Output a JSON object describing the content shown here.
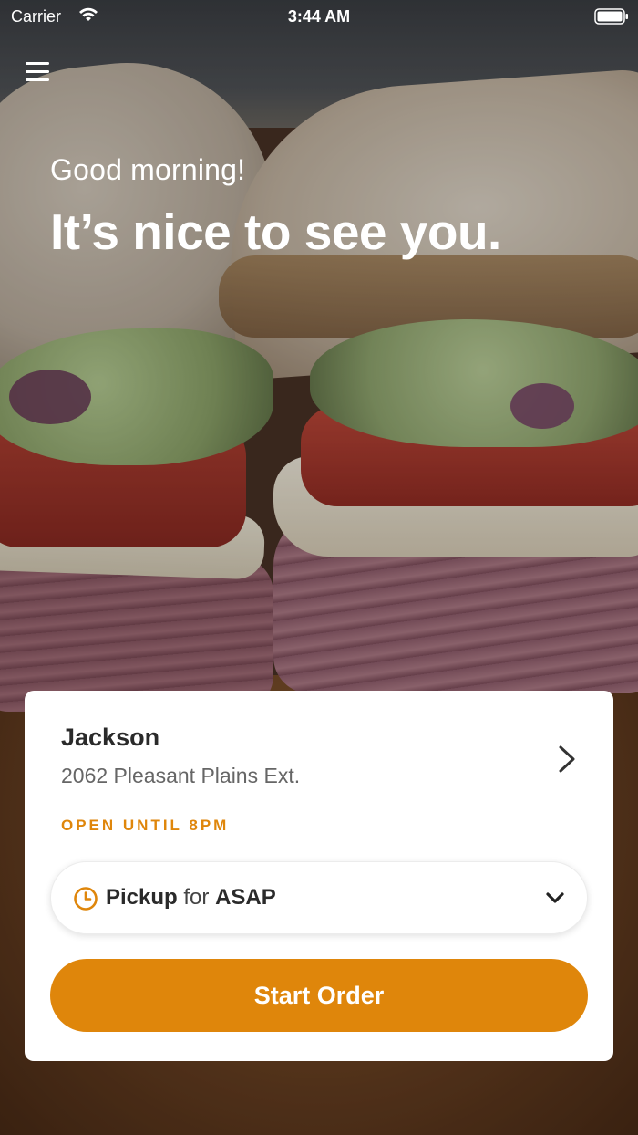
{
  "status_bar": {
    "carrier": "Carrier",
    "time": "3:44 AM"
  },
  "greeting": "Good morning!",
  "headline": "It’s nice to see you.",
  "location": {
    "name": "Jackson",
    "address": "2062 Pleasant Plains Ext.",
    "hours": "OPEN UNTIL 8PM"
  },
  "order_mode": {
    "mode": "Pickup",
    "joiner": "for",
    "time": "ASAP"
  },
  "start_button": "Start Order",
  "colors": {
    "accent": "#df860b",
    "card": "#ffffff"
  },
  "icons": [
    "wifi-icon",
    "battery-icon",
    "hamburger-menu-icon",
    "chevron-right-icon",
    "clock-icon",
    "chevron-down-icon"
  ]
}
